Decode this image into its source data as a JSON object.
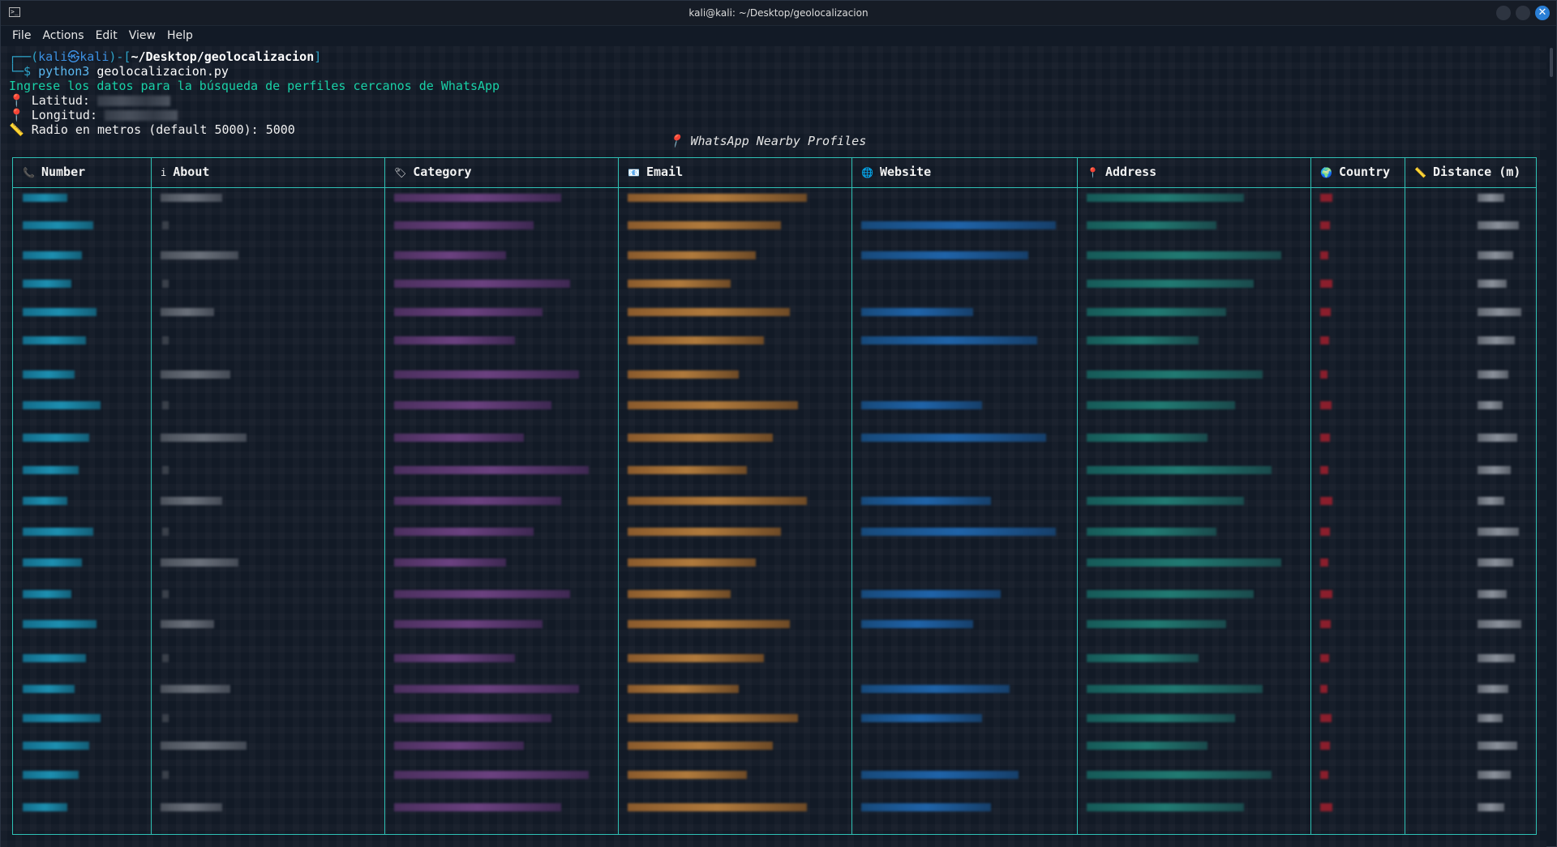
{
  "window": {
    "title": "kali@kali: ~/Desktop/geolocalizacion"
  },
  "menu": [
    "File",
    "Actions",
    "Edit",
    "View",
    "Help"
  ],
  "terminal": {
    "prompt_user": "kali㉿kali",
    "prompt_path": "~/Desktop/geolocalizacion",
    "command": "python3",
    "command_arg": "geolocalizacion.py",
    "intro": "Ingrese los datos para la búsqueda de perfiles cercanos de WhatsApp",
    "lat_label": "Latitud:",
    "lon_label": "Longitud:",
    "radius_line": "Radio en metros (default 5000): 5000",
    "table_title": "WhatsApp Nearby Profiles"
  },
  "table": {
    "headers": [
      {
        "icon": "phone-icon",
        "glyph": "📞",
        "label": "Number"
      },
      {
        "icon": "info-icon",
        "glyph": "i",
        "label": "About"
      },
      {
        "icon": "tag-icon",
        "glyph": "🏷",
        "label": "Category"
      },
      {
        "icon": "mail-icon",
        "glyph": "📧",
        "label": "Email"
      },
      {
        "icon": "globe-icon",
        "glyph": "🌐",
        "label": "Website"
      },
      {
        "icon": "pin-icon",
        "glyph": "📍",
        "label": "Address"
      },
      {
        "icon": "earth-icon",
        "glyph": "🌍",
        "label": "Country"
      },
      {
        "icon": "ruler-icon",
        "glyph": "📏",
        "label": "Distance (m)"
      }
    ],
    "colors": {
      "border": "#2ec1b5",
      "number": "#1d8fb0",
      "category": "#6b4180",
      "email": "#b07a3c",
      "website": "#1f63a8",
      "address": "#217a72",
      "country": "#8a1e2c"
    }
  }
}
